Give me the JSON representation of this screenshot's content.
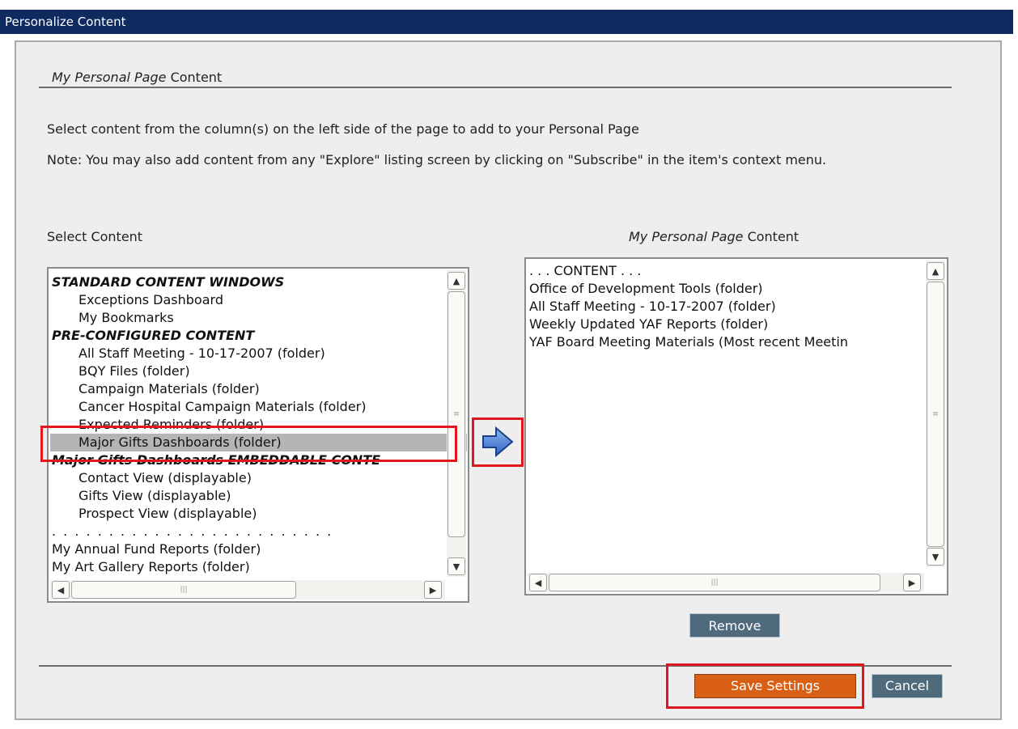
{
  "window": {
    "title": "Personalize Content"
  },
  "page": {
    "section_title_italic": "My Personal Page",
    "section_title_rest": " Content",
    "instruction": "Select content from the column(s) on the left side of the page to add to your Personal Page",
    "note": "Note: You may also add content from any \"Explore\" listing screen by clicking on \"Subscribe\" in the item's context menu."
  },
  "left_list": {
    "label": "Select Content",
    "items": [
      {
        "text": "STANDARD CONTENT WINDOWS",
        "kind": "header"
      },
      {
        "text": "Exceptions Dashboard",
        "kind": "sub"
      },
      {
        "text": "My Bookmarks",
        "kind": "sub"
      },
      {
        "text": "PRE-CONFIGURED CONTENT",
        "kind": "header"
      },
      {
        "text": "All Staff Meeting - 10-17-2007 (folder)",
        "kind": "sub"
      },
      {
        "text": "BQY Files (folder)",
        "kind": "sub"
      },
      {
        "text": "Campaign Materials (folder)",
        "kind": "sub"
      },
      {
        "text": "Cancer Hospital Campaign Materials (folder)",
        "kind": "sub"
      },
      {
        "text": "Expected Reminders (folder)",
        "kind": "sub"
      },
      {
        "text": "Major Gifts Dashboards (folder)",
        "kind": "selected"
      },
      {
        "text": "Major Gifts Dashboards EMBEDDABLE CONTE",
        "kind": "header"
      },
      {
        "text": "Contact View (displayable)",
        "kind": "sub"
      },
      {
        "text": "Gifts View (displayable)",
        "kind": "sub"
      },
      {
        "text": "Prospect View (displayable)",
        "kind": "sub"
      },
      {
        "text": ". . . . . . . . . . . . . . . . . . . . . . . . .",
        "kind": "dots"
      },
      {
        "text": "My Annual Fund Reports (folder)",
        "kind": "plain"
      },
      {
        "text": "My Art Gallery Reports (folder)",
        "kind": "plain"
      }
    ]
  },
  "right_list": {
    "label_italic": "My Personal Page",
    "label_rest": " Content",
    "items": [
      ". . . CONTENT . . .",
      "Office of Development Tools (folder)",
      "All Staff Meeting - 10-17-2007 (folder)",
      "Weekly Updated YAF Reports (folder)",
      "YAF Board Meeting Materials (Most recent Meetin"
    ]
  },
  "buttons": {
    "add_icon": "right-arrow-icon",
    "remove": "Remove",
    "save": "Save Settings",
    "cancel": "Cancel"
  },
  "colors": {
    "title_bar": "#0f2a5e",
    "highlight": "#e0171d",
    "save_button": "#d95f14",
    "secondary_button": "#4e6a7c",
    "selection": "#b5b5b5"
  }
}
